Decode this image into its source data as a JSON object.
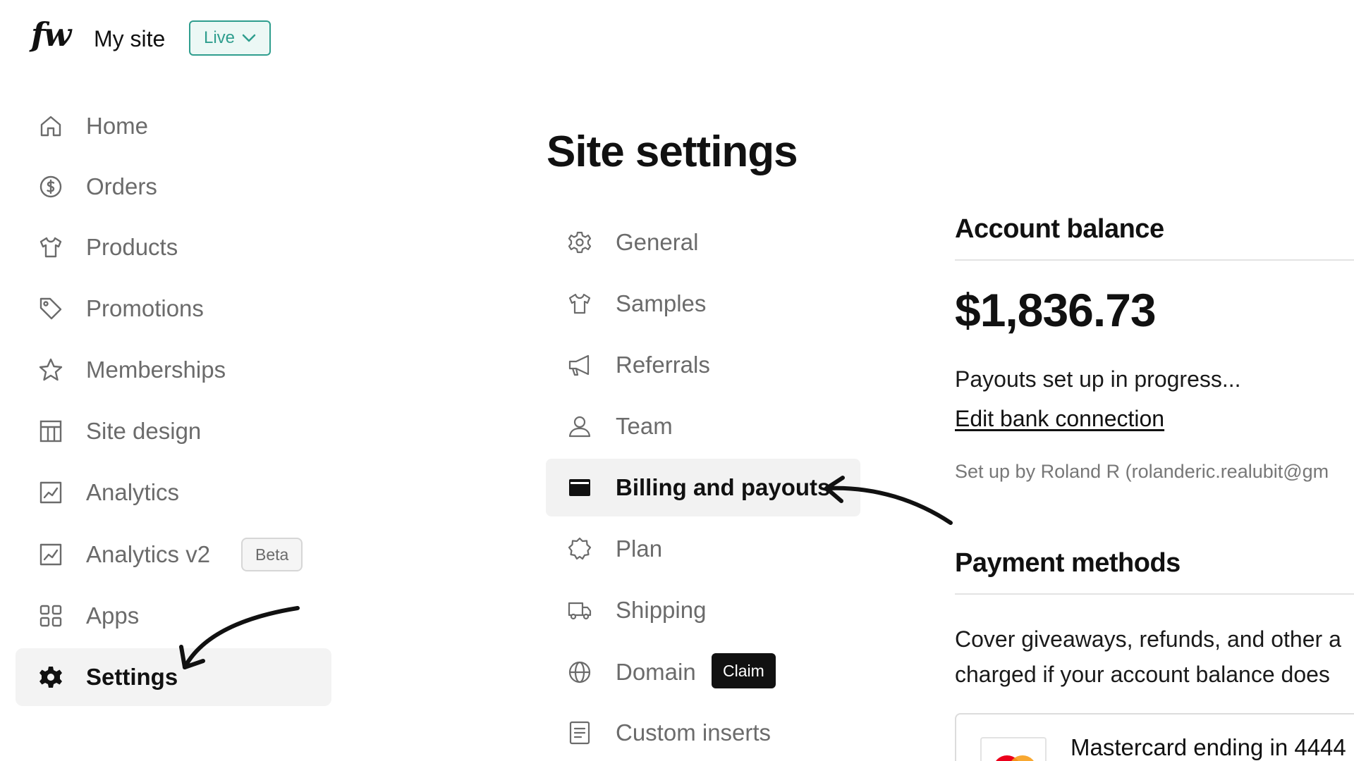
{
  "header": {
    "logo": "fw",
    "site_name": "My site",
    "status_label": "Live"
  },
  "sidebar": {
    "items": [
      {
        "label": "Home",
        "icon": "home-icon"
      },
      {
        "label": "Orders",
        "icon": "dollar-circle-icon"
      },
      {
        "label": "Products",
        "icon": "tshirt-icon"
      },
      {
        "label": "Promotions",
        "icon": "tag-icon"
      },
      {
        "label": "Memberships",
        "icon": "star-icon"
      },
      {
        "label": "Site design",
        "icon": "layout-icon"
      },
      {
        "label": "Analytics",
        "icon": "chart-icon"
      },
      {
        "label": "Analytics v2",
        "icon": "chart-icon",
        "badge": "Beta"
      },
      {
        "label": "Apps",
        "icon": "grid-icon"
      },
      {
        "label": "Settings",
        "icon": "gear-icon",
        "active": true
      }
    ]
  },
  "main": {
    "title": "Site settings",
    "settings_menu": [
      {
        "label": "General",
        "icon": "gear-outline-icon"
      },
      {
        "label": "Samples",
        "icon": "tshirt-icon"
      },
      {
        "label": "Referrals",
        "icon": "megaphone-icon"
      },
      {
        "label": "Team",
        "icon": "user-icon"
      },
      {
        "label": "Billing and payouts",
        "icon": "card-icon",
        "active": true
      },
      {
        "label": "Plan",
        "icon": "badge-icon"
      },
      {
        "label": "Shipping",
        "icon": "truck-icon"
      },
      {
        "label": "Domain",
        "icon": "globe-icon",
        "badge": "Claim"
      },
      {
        "label": "Custom inserts",
        "icon": "document-icon"
      }
    ]
  },
  "billing": {
    "account_balance_title": "Account balance",
    "balance": "$1,836.73",
    "payout_status": "Payouts set up in progress...",
    "edit_bank_link": "Edit bank connection",
    "setup_by": "Set up by Roland R (rolanderic.realubit@gm",
    "payment_methods_title": "Payment methods",
    "payment_methods_desc_line1": "Cover giveaways, refunds, and other a",
    "payment_methods_desc_line2": "charged if your account balance does",
    "card_label": "Mastercard ending in 4444"
  },
  "colors": {
    "accent": "#2f9e8e",
    "accent_bg": "#ecf8f5",
    "active_bg": "#f3f3f3",
    "muted_text": "#6b6b6b"
  }
}
